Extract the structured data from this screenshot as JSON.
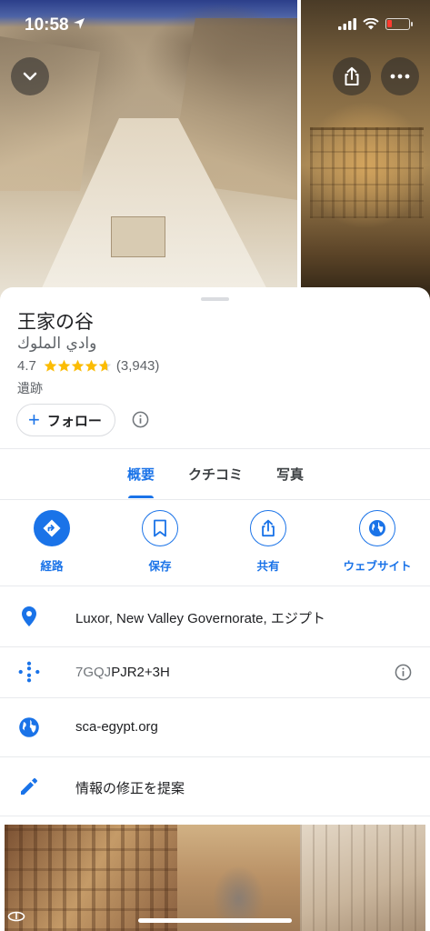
{
  "status_bar": {
    "time": "10:58"
  },
  "place": {
    "title": "王家の谷",
    "subtitle": "وادي الملوك",
    "rating": "4.7",
    "rating_value": 4.7,
    "review_count": "(3,943)",
    "category": "遺跡"
  },
  "follow": {
    "label": "フォロー"
  },
  "tabs": [
    {
      "label": "概要",
      "active": true
    },
    {
      "label": "クチコミ",
      "active": false
    },
    {
      "label": "写真",
      "active": false
    }
  ],
  "actions": [
    {
      "label": "経路",
      "icon": "directions-icon"
    },
    {
      "label": "保存",
      "icon": "bookmark-icon"
    },
    {
      "label": "共有",
      "icon": "share-icon"
    },
    {
      "label": "ウェブサイト",
      "icon": "globe-icon"
    }
  ],
  "info": {
    "address": "Luxor, New Valley Governorate, エジプト",
    "plus_code_prefix": "7GQJ",
    "plus_code_rest": "PJR2+3H",
    "website": "sca-egypt.org",
    "suggest_edit": "情報の修正を提案"
  },
  "colors": {
    "accent": "#1a73e8",
    "star": "#fbbc04",
    "secondary_text": "#5f6368"
  }
}
